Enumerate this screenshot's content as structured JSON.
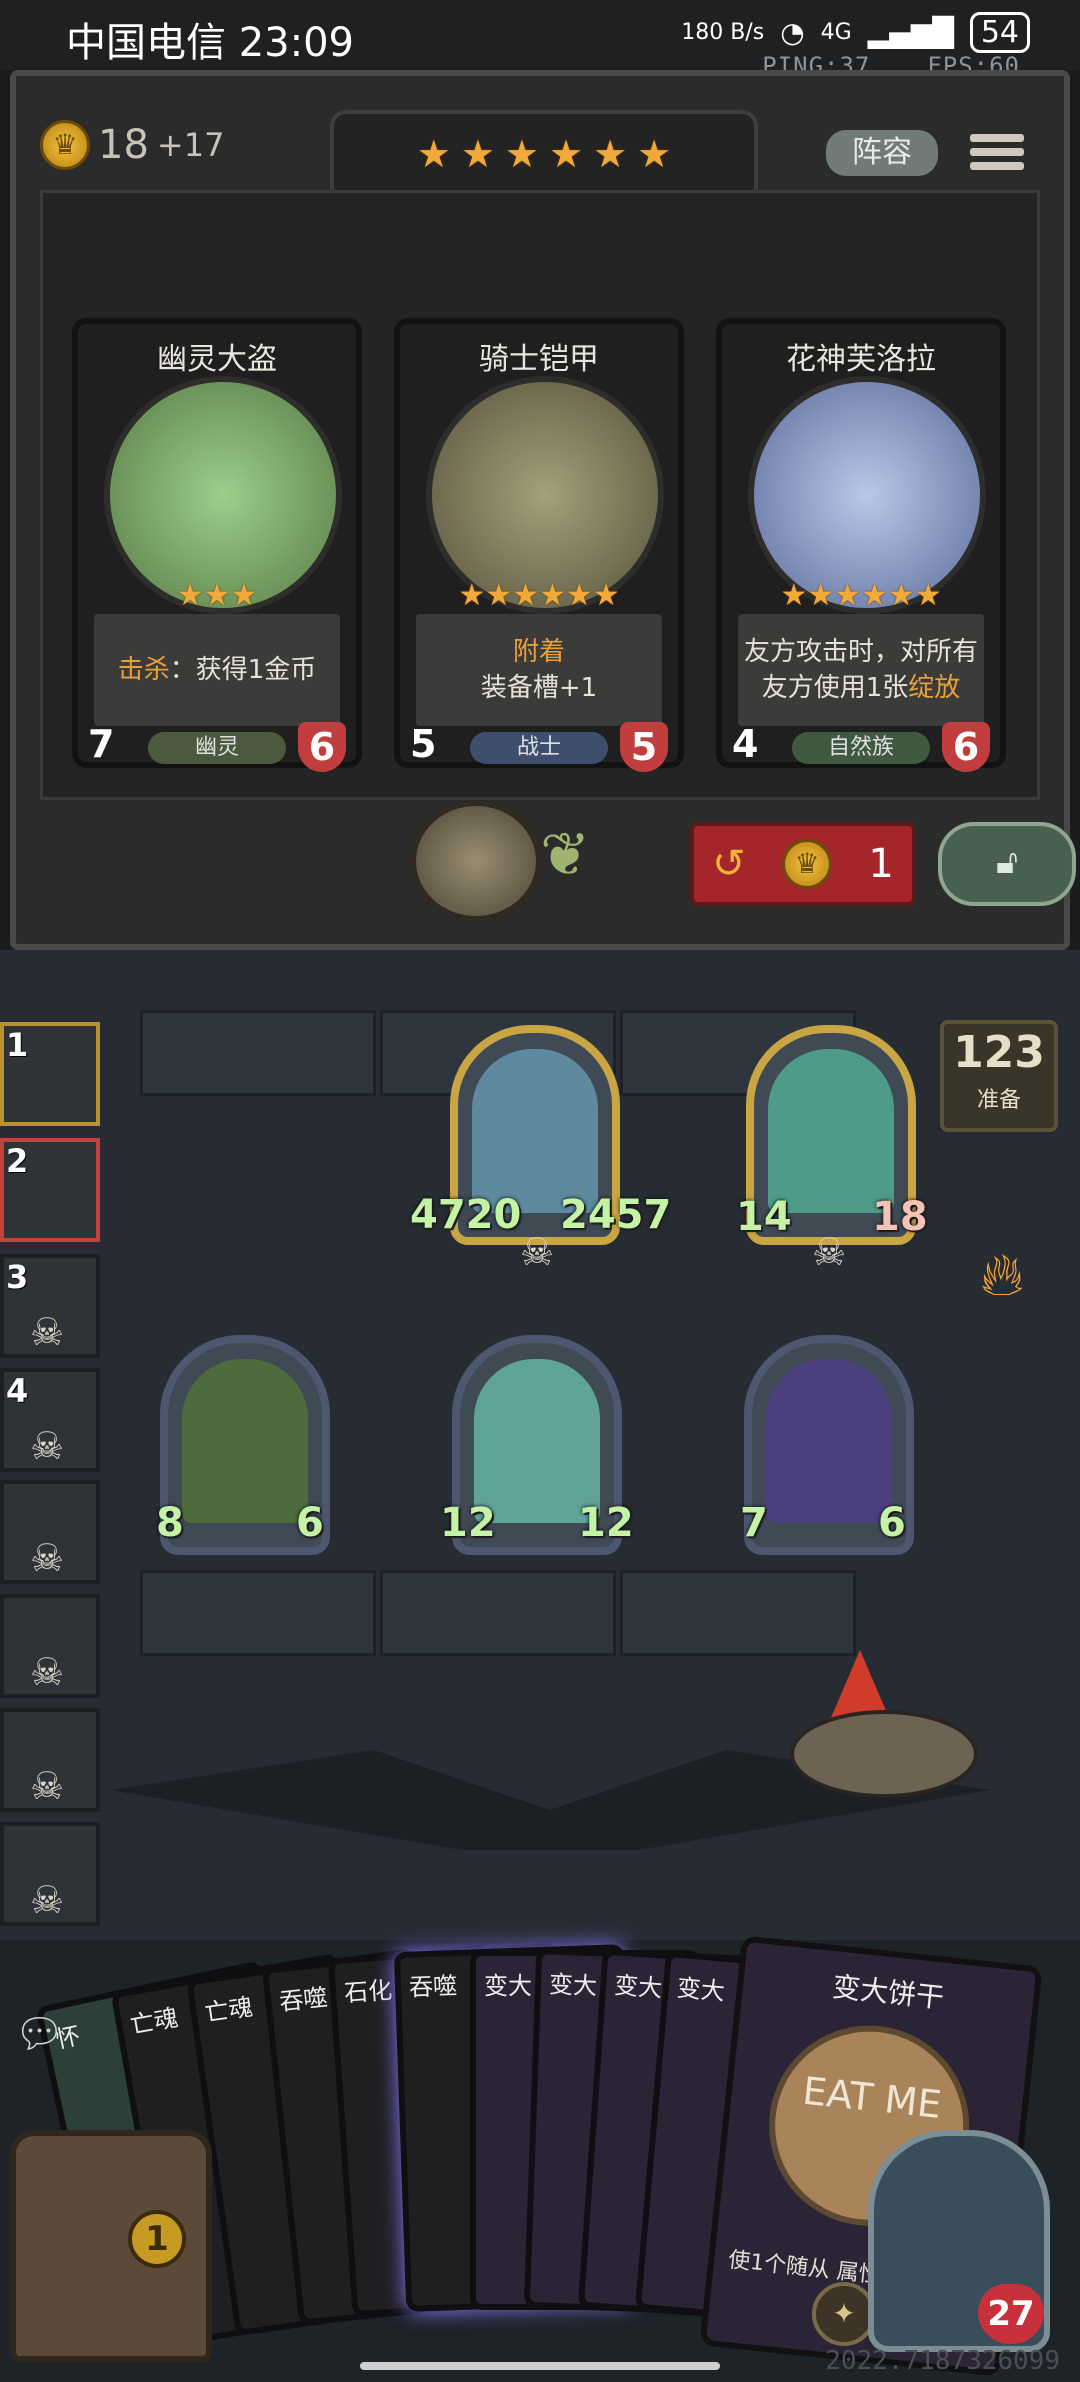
{
  "status_bar": {
    "carrier_time": "中国电信 23:09",
    "net_speed": "180 B/s",
    "signal": "4G",
    "battery": "54",
    "ping": "PING:37",
    "fps": "FPS:60"
  },
  "shop": {
    "gold": "18",
    "gold_income": "+17",
    "tier_stars": 6,
    "lineup_label": "阵容",
    "refresh_cost": "1",
    "cards": [
      {
        "name": "幽灵大盗",
        "stars": 3,
        "desc_html": [
          "击杀：获得1金币"
        ],
        "highlight": "击杀",
        "attack": "7",
        "health": "6",
        "tribe": "幽灵",
        "art_color": "#6fbf67"
      },
      {
        "name": "骑士铠甲",
        "stars": 6,
        "desc_line1": "附着",
        "desc_line2": "装备槽+1",
        "attack": "5",
        "health": "5",
        "tribe": "战士",
        "art_color": "#6f6d67"
      },
      {
        "name": "花神芙洛拉",
        "stars": 6,
        "desc_line1": "友方攻击时，对所有",
        "desc_line2": "友方使用1张绽放",
        "attack": "4",
        "health": "6",
        "tribe": "自然族",
        "art_color": "#7a8fb5"
      }
    ]
  },
  "board": {
    "ready_count": "123",
    "ready_label": "准备",
    "minions": [
      {
        "id": "m1",
        "attack": "4720",
        "health": "2457",
        "gold": true,
        "art": "#5e8aa0"
      },
      {
        "id": "m2",
        "attack": "14",
        "health": "18",
        "gold": true,
        "art": "#4e9b8a"
      },
      {
        "id": "m3",
        "attack": "8",
        "health": "6",
        "gold": false,
        "art": "#4e6b3e"
      },
      {
        "id": "m4",
        "attack": "12",
        "health": "12",
        "gold": false,
        "art": "#5fa39a"
      },
      {
        "id": "m5",
        "attack": "7",
        "health": "6",
        "gold": false,
        "art": "#4b3f7e"
      }
    ]
  },
  "roster": [
    {
      "num": "1",
      "dead": false
    },
    {
      "num": "2",
      "dead": false
    },
    {
      "num": "3",
      "dead": true
    },
    {
      "num": "4",
      "dead": true
    },
    {
      "num": "",
      "dead": true
    },
    {
      "num": "",
      "dead": true
    },
    {
      "num": "",
      "dead": true
    },
    {
      "num": "",
      "dead": true
    }
  ],
  "hand": {
    "cards": [
      "怀",
      "亡魂",
      "亡魂",
      "吞噬",
      "石化",
      "吞噬",
      "变大",
      "变大",
      "变大",
      "变大"
    ],
    "featured": {
      "name": "变大饼干",
      "art_text": "EAT ME",
      "desc": "使1个随从 属性翻倍"
    },
    "chest_count": "1",
    "hero_health": "27"
  },
  "footer": {
    "uid": "2022.7187326099"
  }
}
